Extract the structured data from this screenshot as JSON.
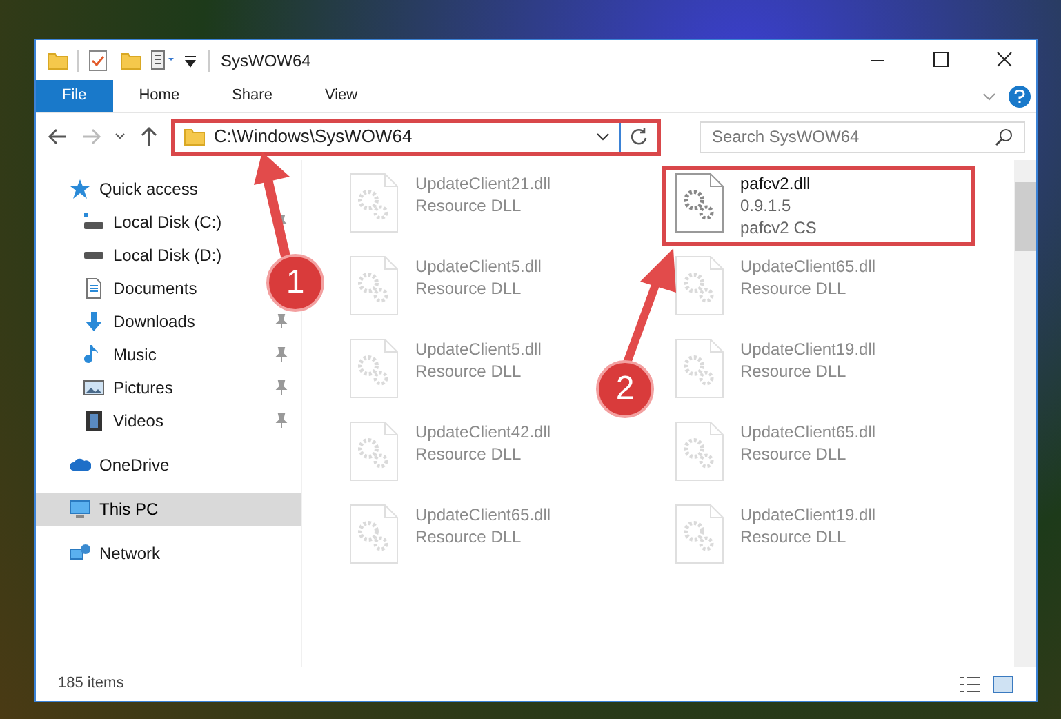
{
  "window": {
    "title": "SysWOW64"
  },
  "ribbon_tabs": [
    {
      "label": "File",
      "selected": true
    },
    {
      "label": "Home",
      "selected": false
    },
    {
      "label": "Share",
      "selected": false
    },
    {
      "label": "View",
      "selected": false
    }
  ],
  "address_bar": {
    "path": "C:\\Windows\\SysWOW64",
    "highlighted": true
  },
  "search": {
    "placeholder": "Search SysWOW64"
  },
  "navigation": [
    {
      "label": "Quick access",
      "selected": false,
      "children": [
        {
          "label": "Local Disk (C:)",
          "pinned": true,
          "selected": false
        },
        {
          "label": "Local Disk (D:)",
          "selected": false
        },
        {
          "label": "Documents",
          "selected": false
        },
        {
          "label": "Downloads",
          "pinned": true,
          "selected": false
        },
        {
          "label": "Music",
          "pinned": true,
          "selected": false
        },
        {
          "label": "Pictures",
          "pinned": true,
          "selected": false
        },
        {
          "label": "Videos",
          "pinned": true,
          "selected": false
        }
      ]
    },
    {
      "label": "OneDrive",
      "selected": false
    },
    {
      "label": "This PC",
      "selected": true
    },
    {
      "label": "Network",
      "selected": false
    }
  ],
  "files": [
    {
      "lines": [
        "UpdateClient21.dll",
        "Resource DLL"
      ],
      "blurred": true,
      "highlighted": false
    },
    {
      "lines": [
        "pafcv2.dll",
        "0.9.1.5",
        "pafcv2 CS"
      ],
      "blurred": false,
      "highlighted": true
    },
    {
      "lines": [
        "UpdateClient5.dll",
        "Resource DLL"
      ],
      "blurred": true,
      "highlighted": false
    },
    {
      "lines": [
        "UpdateClient65.dll",
        "Resource DLL"
      ],
      "blurred": true,
      "highlighted": false
    },
    {
      "lines": [
        "UpdateClient5.dll",
        "Resource DLL"
      ],
      "blurred": true,
      "highlighted": false
    },
    {
      "lines": [
        "UpdateClient19.dll",
        "Resource DLL"
      ],
      "blurred": true,
      "highlighted": false
    },
    {
      "lines": [
        "UpdateClient42.dll",
        "Resource DLL"
      ],
      "blurred": true,
      "highlighted": false
    },
    {
      "lines": [
        "UpdateClient65.dll",
        "Resource DLL"
      ],
      "blurred": true,
      "highlighted": false
    },
    {
      "lines": [
        "UpdateClient65.dll",
        "Resource DLL"
      ],
      "blurred": true,
      "highlighted": false
    },
    {
      "lines": [
        "UpdateClient19.dll",
        "Resource DLL"
      ],
      "blurred": true,
      "highlighted": false
    }
  ],
  "status_bar": {
    "count": "185 items"
  },
  "annotations": [
    {
      "number": "1"
    },
    {
      "number": "2"
    }
  ]
}
